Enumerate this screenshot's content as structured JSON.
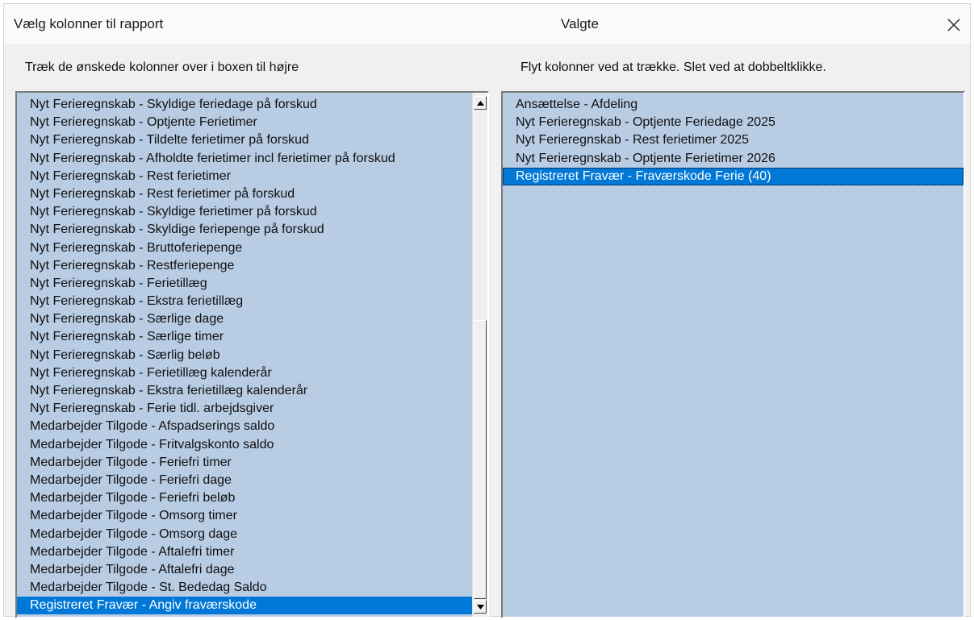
{
  "window": {
    "title": "Vælg kolonner til rapport",
    "center_title": "Valgte",
    "close_icon": "close-icon"
  },
  "left_panel": {
    "instruction": "Træk de ønskede kolonner over i boxen til højre",
    "items": [
      "Nyt Ferieregnskab - Skyldige feriedage på forskud",
      "Nyt Ferieregnskab - Optjente Ferietimer",
      "Nyt Ferieregnskab - Tildelte ferietimer på forskud",
      "Nyt Ferieregnskab - Afholdte ferietimer incl ferietimer på forskud",
      "Nyt Ferieregnskab - Rest ferietimer",
      "Nyt Ferieregnskab - Rest ferietimer på forskud",
      "Nyt Ferieregnskab - Skyldige ferietimer på forskud",
      "Nyt Ferieregnskab - Skyldige feriepenge på forskud",
      "Nyt Ferieregnskab - Bruttoferiepenge",
      "Nyt Ferieregnskab - Restferiepenge",
      "Nyt Ferieregnskab - Ferietillæg",
      "Nyt Ferieregnskab - Ekstra ferietillæg",
      "Nyt Ferieregnskab - Særlige dage",
      "Nyt Ferieregnskab - Særlige timer",
      "Nyt Ferieregnskab - Særlig beløb",
      "Nyt Ferieregnskab - Ferietillæg kalenderår",
      "Nyt Ferieregnskab - Ekstra ferietillæg kalenderår",
      "Nyt Ferieregnskab - Ferie tidl. arbejdsgiver",
      "Medarbejder Tilgode - Afspadserings saldo",
      "Medarbejder Tilgode - Fritvalgskonto saldo",
      "Medarbejder Tilgode - Feriefri timer",
      "Medarbejder Tilgode - Feriefri dage",
      "Medarbejder Tilgode - Feriefri beløb",
      "Medarbejder Tilgode - Omsorg timer",
      "Medarbejder Tilgode - Omsorg dage",
      "Medarbejder Tilgode - Aftalefri timer",
      "Medarbejder Tilgode - Aftalefri dage",
      "Medarbejder Tilgode - St. Bededag Saldo",
      "Registreret Fravær - Angiv fraværskode"
    ],
    "selected_index": 28,
    "scroll_up_icon": "scroll-up-arrow-icon",
    "scroll_down_icon": "scroll-down-arrow-icon"
  },
  "right_panel": {
    "instruction": "Flyt kolonner ved at trække. Slet ved at dobbeltklikke.",
    "items": [
      "Ansættelse - Afdeling",
      "Nyt Ferieregnskab - Optjente Feriedage 2025",
      "Nyt Ferieregnskab - Rest ferietimer 2025",
      "Nyt Ferieregnskab - Optjente Ferietimer 2026",
      "Registreret Fravær - Fraværskode Ferie (40)"
    ],
    "selected_index": 4
  },
  "colors": {
    "list_background": "#b8cce4",
    "selection": "#0078d7"
  }
}
